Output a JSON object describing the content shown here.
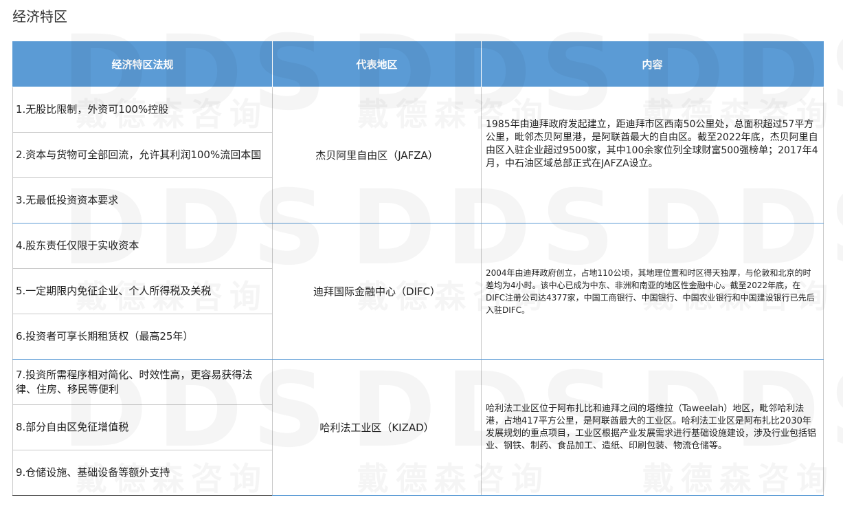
{
  "page": {
    "title": "经济特区"
  },
  "table": {
    "headers": {
      "regulation": "经济特区法规",
      "area": "代表地区",
      "content": "内容"
    },
    "groups": [
      {
        "area": "杰贝阿里自由区（JAFZA）",
        "content": "1985年由迪拜政府发起建立，距迪拜市区西南50公里处，总面积超过57平方公里，毗邻杰贝阿里港，是阿联酋最大的自由区。截至2022年底，杰贝阿里自由区入驻企业超过9500家，其中100余家位列全球财富500强榜单；2017年4月，中石油区域总部正式在JAFZA设立。",
        "regulations": [
          "1.无股比限制，外资可100%控股",
          "2.资本与货物可全部回流，允许其利润100%流回本国",
          "3.无最低投资资本要求"
        ]
      },
      {
        "area": "迪拜国际金融中心（DIFC）",
        "content": "2004年由迪拜政府创立，占地110公顷，其地理位置和时区得天独厚，与伦敦和北京的时差均为4小时。该中心已成为中东、非洲和南亚的地区性金融中心。截至2022年底，在DIFC注册公司达4377家，中国工商银行、中国银行、中国农业银行和中国建设银行已先后入驻DIFC。",
        "regulations": [
          "4.股东责任仅限于实收资本",
          "5.一定期限内免征企业、个人所得税及关税",
          "6.投资者可享长期租赁权（最高25年）"
        ]
      },
      {
        "area": "哈利法工业区（KIZAD）",
        "content": "哈利法工业区位于阿布扎比和迪拜之间的塔维拉（Taweelah）地区，毗邻哈利法港，占地417平方公里，是阿联酋最大的工业区。哈利法工业区是阿布扎比2030年发展规划的重点项目，工业区根据产业发展需求进行基础设施建设，涉及行业包括铝业、钢铁、制药、食品加工、造纸、印刷包装、物流仓储等。",
        "regulations": [
          "7.投资所需程序相对简化、时效性高，更容易获得法律、住房、移民等便利",
          "8.部分自由区免征增值税",
          "9.仓储设施、基础设备等额外支持"
        ]
      }
    ]
  },
  "watermark": {
    "letters": "DDS",
    "chinese": "戴德森咨询"
  }
}
